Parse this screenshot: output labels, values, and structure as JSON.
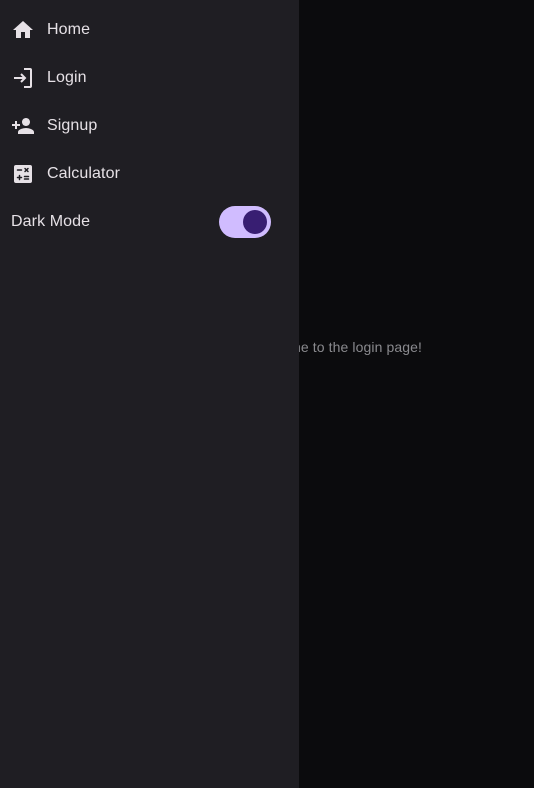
{
  "background_page": {
    "text": "Welcome to the login page!"
  },
  "drawer": {
    "items": [
      {
        "label": "Home",
        "icon": "home-icon"
      },
      {
        "label": "Login",
        "icon": "login-icon"
      },
      {
        "label": "Signup",
        "icon": "person-add-icon"
      },
      {
        "label": "Calculator",
        "icon": "calculator-icon"
      }
    ],
    "dark_mode": {
      "label": "Dark Mode",
      "enabled": true
    }
  },
  "colors": {
    "drawer_bg": "#1f1e23",
    "scrim_bg": "#0b0b0d",
    "switch_track": "#d0bcff",
    "switch_thumb": "#381e72",
    "text": "#e6e1e6"
  }
}
